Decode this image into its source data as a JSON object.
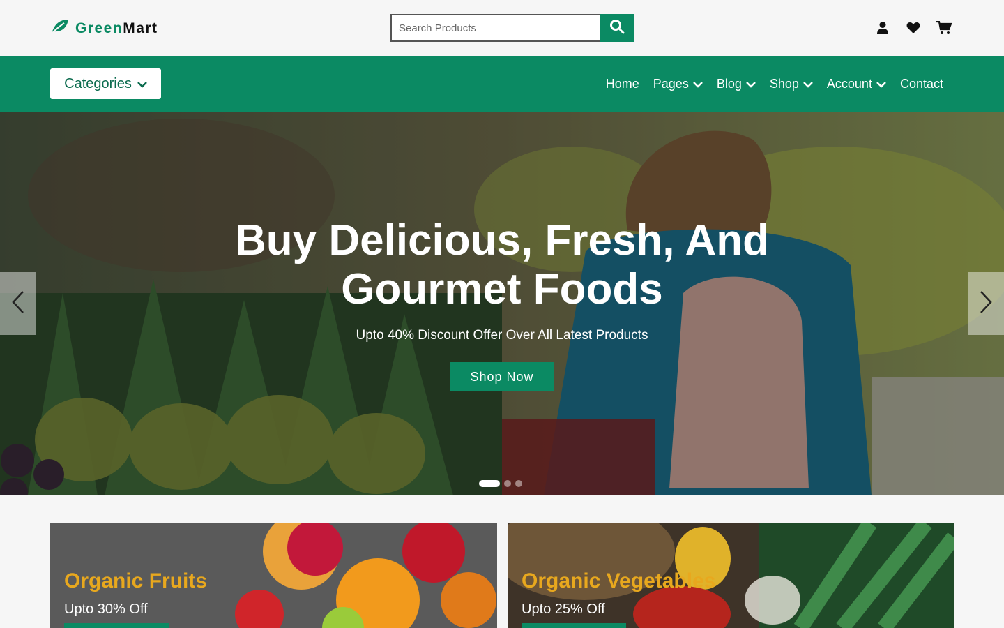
{
  "brand": {
    "name_part1": "Green",
    "name_part2": "Mart",
    "accent": "#0b8a63",
    "highlight": "#e8a81e"
  },
  "header": {
    "search_placeholder": "Search Products",
    "icons": [
      "user-icon",
      "heart-icon",
      "cart-icon"
    ]
  },
  "nav": {
    "categories_label": "Categories",
    "items": [
      {
        "label": "Home",
        "has_dropdown": false
      },
      {
        "label": "Pages",
        "has_dropdown": true
      },
      {
        "label": "Blog",
        "has_dropdown": true
      },
      {
        "label": "Shop",
        "has_dropdown": true
      },
      {
        "label": "Account",
        "has_dropdown": true
      },
      {
        "label": "Contact",
        "has_dropdown": false
      }
    ]
  },
  "hero": {
    "title_line1": "Buy Delicious, Fresh, And",
    "title_line2": "Gourmet Foods",
    "subtitle": "Upto 40% Discount Offer Over All Latest Products",
    "cta_label": "Shop Now",
    "slides_total": 3,
    "active_slide": 1
  },
  "promos": [
    {
      "title": "Organic Fruits",
      "subtitle": "Upto 30% Off"
    },
    {
      "title": "Organic Vegetables",
      "subtitle": "Upto 25% Off"
    }
  ]
}
